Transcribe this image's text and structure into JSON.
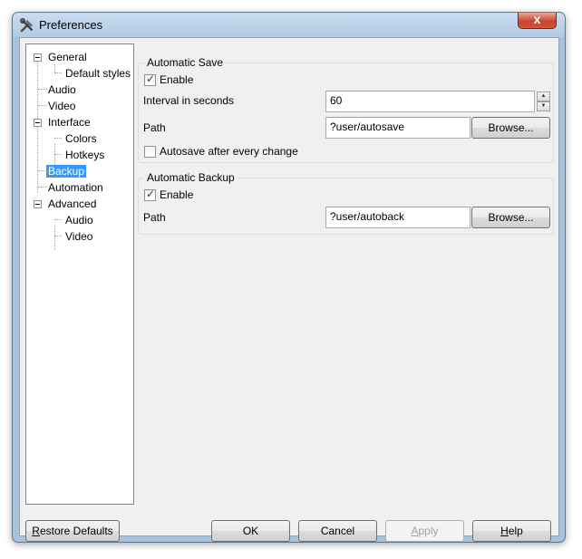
{
  "window": {
    "title": "Preferences",
    "close_glyph": "x"
  },
  "tree": {
    "items": [
      {
        "label": "General",
        "level": 0,
        "expanded": true
      },
      {
        "label": "Default styles",
        "level": 1
      },
      {
        "label": "Audio",
        "level": 0
      },
      {
        "label": "Video",
        "level": 0
      },
      {
        "label": "Interface",
        "level": 0,
        "expanded": true
      },
      {
        "label": "Colors",
        "level": 1
      },
      {
        "label": "Hotkeys",
        "level": 1
      },
      {
        "label": "Backup",
        "level": 0,
        "selected": true
      },
      {
        "label": "Automation",
        "level": 0
      },
      {
        "label": "Advanced",
        "level": 0,
        "expanded": true
      },
      {
        "label": "Audio",
        "level": 1
      },
      {
        "label": "Video",
        "level": 1
      }
    ]
  },
  "automatic_save": {
    "title": "Automatic Save",
    "enable_label": "Enable",
    "enable_checked": true,
    "interval_label": "Interval in seconds",
    "interval_value": "60",
    "path_label": "Path",
    "path_value": "?user/autosave",
    "browse_label": "Browse...",
    "every_change_label": "Autosave after every change",
    "every_change_checked": false
  },
  "automatic_backup": {
    "title": "Automatic Backup",
    "enable_label": "Enable",
    "enable_checked": true,
    "path_label": "Path",
    "path_value": "?user/autoback",
    "browse_label": "Browse..."
  },
  "buttons": {
    "restore_first": "R",
    "restore_rest": "estore Defaults",
    "ok": "OK",
    "cancel": "Cancel",
    "apply_first": "A",
    "apply_rest": "pply",
    "help_first": "H",
    "help_rest": "elp"
  },
  "colors": {
    "selection": "#3399ff",
    "frame": "#a9c3dd",
    "close": "#c7452f"
  }
}
